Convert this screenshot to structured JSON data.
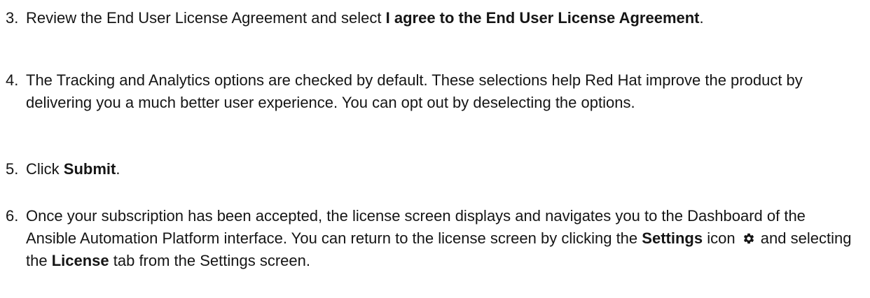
{
  "steps": [
    {
      "number": "3.",
      "text_before": "Review the End User License Agreement and select ",
      "bold": "I agree to the End User License Agreement",
      "text_after": "."
    },
    {
      "number": "4.",
      "text": "The Tracking and Analytics options are checked by default. These selections help Red Hat improve the product by delivering you a much better user experience. You can opt out by deselecting the options."
    },
    {
      "number": "5.",
      "text_before": "Click ",
      "bold": "Submit",
      "text_after": "."
    },
    {
      "number": "6.",
      "text_1": "Once your subscription has been accepted, the license screen displays and navigates you to the Dashboard of the Ansible Automation Platform interface. You can return to the license screen by clicking the ",
      "bold_settings": "Settings",
      "text_2": " icon ",
      "icon": "gear-icon",
      "text_3": " and selecting the ",
      "bold_license": "License",
      "text_4": " tab from the Settings screen."
    }
  ]
}
